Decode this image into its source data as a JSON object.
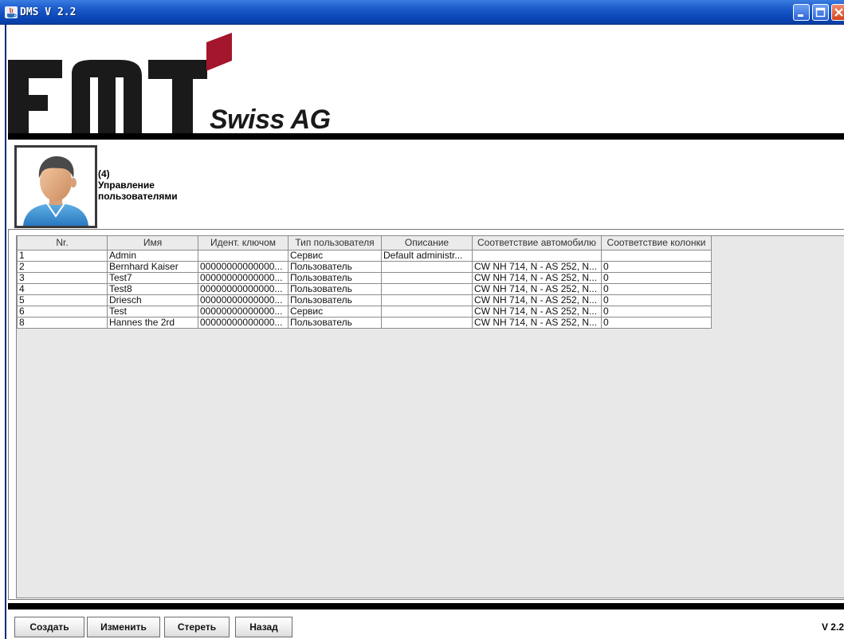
{
  "window": {
    "title": "DMS V 2.2",
    "controls": {
      "minimize": "minimize-icon",
      "maximize": "maximize-icon",
      "close": "close-icon"
    }
  },
  "header": {
    "logo_text": "Swiss AG",
    "logo_colors": {
      "letters": "#1a1a1a",
      "accent": "#a3162b"
    }
  },
  "user_panel": {
    "avatar_icon": "user-avatar-icon",
    "line1": "(4)",
    "line2": "Управление",
    "line3": "пользователями"
  },
  "table": {
    "columns": [
      "Nr.",
      "Имя",
      "Идент. ключом",
      "Тип пользователя",
      "Описание",
      "Соответствие автомобилю",
      "Соответствие колонки"
    ],
    "rows": [
      [
        "1",
        "Admin",
        "",
        "Сервис",
        "Default administr...",
        "",
        ""
      ],
      [
        "2",
        "Bernhard Kaiser",
        "00000000000000...",
        "Пользователь",
        "",
        "CW NH 714, N - AS 252, N...",
        "0"
      ],
      [
        "3",
        "Test7",
        "00000000000000...",
        "Пользователь",
        "",
        "CW NH 714, N - AS 252, N...",
        "0"
      ],
      [
        "4",
        "Test8",
        "00000000000000...",
        "Пользователь",
        "",
        "CW NH 714, N - AS 252, N...",
        "0"
      ],
      [
        "5",
        "Driesch",
        "00000000000000...",
        "Пользователь",
        "",
        "CW NH 714, N - AS 252, N...",
        "0"
      ],
      [
        "6",
        "Test",
        "00000000000000...",
        "Сервис",
        "",
        "CW NH 714, N - AS 252, N...",
        "0"
      ],
      [
        "8",
        "Hannes the 2rd",
        "00000000000000...",
        "Пользователь",
        "",
        "CW NH 714, N - AS 252, N...",
        "0"
      ]
    ]
  },
  "footer": {
    "create": "Создать",
    "edit": "Изменить",
    "delete": "Стереть",
    "back": "Назад",
    "version": "V 2.2"
  }
}
